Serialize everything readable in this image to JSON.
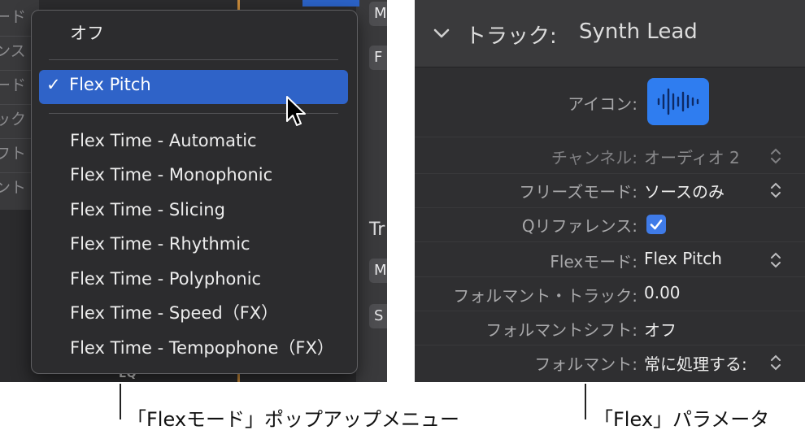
{
  "left_panel": {
    "background_labels": [
      "ード",
      "ンス",
      "ード",
      "ック",
      "フト",
      "ント"
    ],
    "side_buttons": [
      "M",
      "F",
      "M",
      "S"
    ],
    "track_label_partial": "Tr",
    "eq_label": "EQ"
  },
  "flex_mode_menu": {
    "items": [
      {
        "label": "オフ"
      },
      {
        "label": "Flex Pitch",
        "selected": true,
        "checkmark": "✓"
      },
      {
        "label": "Flex Time - Automatic"
      },
      {
        "label": "Flex Time - Monophonic"
      },
      {
        "label": "Flex Time - Slicing"
      },
      {
        "label": "Flex Time - Rhythmic"
      },
      {
        "label": "Flex Time - Polyphonic"
      },
      {
        "label": "Flex Time - Speed（FX）"
      },
      {
        "label": "Flex Time - Tempophone（FX）"
      }
    ],
    "selection_color": "#2f63c8"
  },
  "track_inspector": {
    "header_prefix": "トラック:",
    "header_track_name": "Synth Lead",
    "rows": {
      "icon": {
        "label": "アイコン:",
        "icon_name": "waveform-icon",
        "color": "#2f7df0"
      },
      "channel": {
        "label": "チャンネル:",
        "value": "オーディオ 2"
      },
      "freeze_mode": {
        "label": "フリーズモード:",
        "value": "ソースのみ"
      },
      "q_reference": {
        "label": "Qリファレンス:",
        "checked": true
      },
      "flex_mode": {
        "label": "Flexモード:",
        "value": "Flex Pitch"
      },
      "formant_track": {
        "label": "フォルマント・トラック:",
        "value": "0.00"
      },
      "formant_shift": {
        "label": "フォルマントシフト:",
        "value": "オフ"
      },
      "formant": {
        "label": "フォルマント:",
        "value": "常に処理する:"
      }
    }
  },
  "captions": {
    "left": "「Flexモード」ポップアップメニュー",
    "right": "「Flex」パラメータ"
  }
}
